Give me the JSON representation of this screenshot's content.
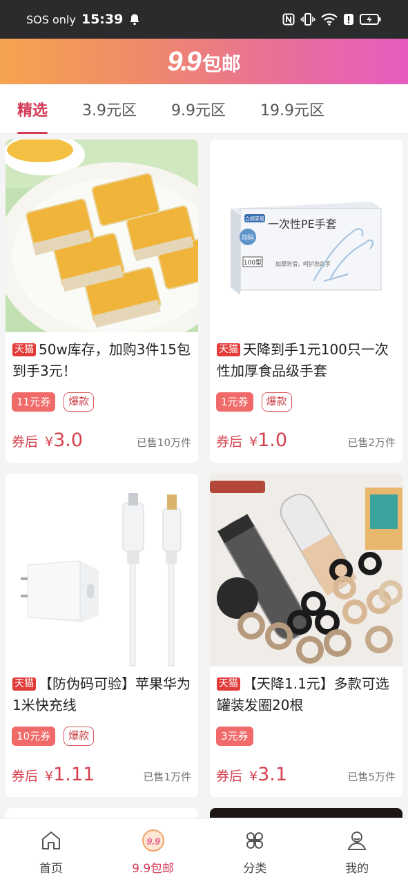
{
  "status_bar": {
    "carrier": "SOS only",
    "time": "15:39",
    "icons": [
      "bell-icon",
      "nfc-icon",
      "vibrate-icon",
      "wifi-icon",
      "alert-icon",
      "battery-charging-icon"
    ]
  },
  "header": {
    "logo_number": "9.9",
    "logo_text": "包邮"
  },
  "tabs": [
    {
      "label": "精选",
      "active": true
    },
    {
      "label": "3.9元区",
      "active": false
    },
    {
      "label": "9.9元区",
      "active": false
    },
    {
      "label": "19.9元区",
      "active": false
    }
  ],
  "products": [
    {
      "platform": "天猫",
      "title": "50w库存，加购3件15包到手3元！",
      "coupon": "11元券",
      "tag": "爆款",
      "price_prefix": "券后",
      "currency": "¥",
      "price": "3.0",
      "sold": "已售10万件"
    },
    {
      "platform": "天猫",
      "title": "天降到手1元100只一次性加厚食品级手套",
      "coupon": "1元券",
      "tag": "爆款",
      "price_prefix": "券后",
      "currency": "¥",
      "price": "1.0",
      "sold": "已售2万件",
      "box_brand": "立顺家居",
      "box_title": "一次性PE手套",
      "box_badge": "均码",
      "box_count": "100型",
      "box_note": "加厚防滑，呵护您的手"
    },
    {
      "platform": "天猫",
      "title": "【防伪码可验】苹果华为1米快充线",
      "coupon": "10元券",
      "tag": "爆款",
      "price_prefix": "券后",
      "currency": "¥",
      "price": "1.11",
      "sold": "已售1万件"
    },
    {
      "platform": "天猫",
      "title": "【天降1.1元】多款可选罐装发圈20根",
      "coupon": "3元券",
      "tag": "",
      "price_prefix": "券后",
      "currency": "¥",
      "price": "3.1",
      "sold": "已售5万件"
    }
  ],
  "bottom_nav": [
    {
      "label": "首页",
      "icon": "home-icon",
      "active": false
    },
    {
      "label": "9.9包邮",
      "icon": "nine-nine-icon",
      "active": true
    },
    {
      "label": "分类",
      "icon": "category-icon",
      "active": false
    },
    {
      "label": "我的",
      "icon": "profile-icon",
      "active": false
    }
  ],
  "colors": {
    "accent": "#d23a55",
    "coupon": "#ef6a68",
    "tmall": "#e33a3a",
    "header_start": "#f5a44f",
    "header_end": "#e65cc0"
  }
}
